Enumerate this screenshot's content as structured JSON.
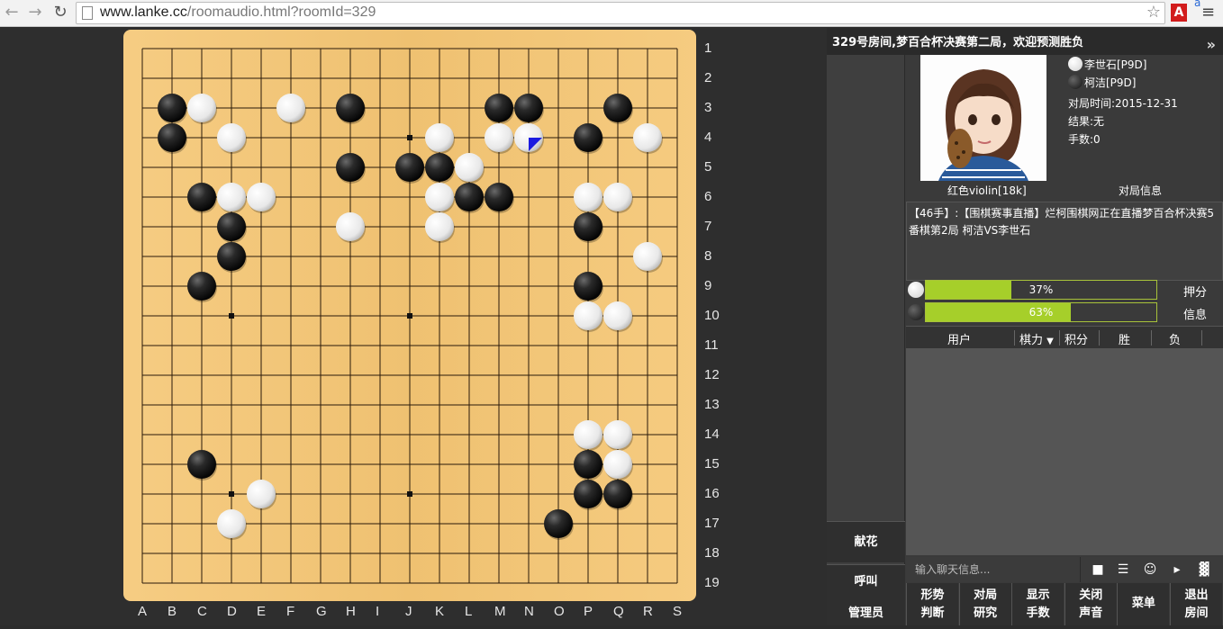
{
  "browser": {
    "url_host": "www.lanke.cc",
    "url_path": "/roomaudio.html?roomId=329",
    "ext_label": "A",
    "ext_badge": "a"
  },
  "board": {
    "size": 19,
    "col_labels": [
      "A",
      "B",
      "C",
      "D",
      "E",
      "F",
      "G",
      "H",
      "I",
      "J",
      "K",
      "L",
      "M",
      "N",
      "O",
      "P",
      "Q",
      "R",
      "S"
    ],
    "row_labels": [
      "1",
      "2",
      "3",
      "4",
      "5",
      "6",
      "7",
      "8",
      "9",
      "10",
      "11",
      "12",
      "13",
      "14",
      "15",
      "16",
      "17",
      "18",
      "19"
    ],
    "hoshi": [
      [
        4,
        4
      ],
      [
        10,
        4
      ],
      [
        16,
        4
      ],
      [
        4,
        10
      ],
      [
        10,
        10
      ],
      [
        16,
        10
      ],
      [
        4,
        16
      ],
      [
        10,
        16
      ],
      [
        16,
        16
      ]
    ],
    "black_stones": [
      [
        2,
        3
      ],
      [
        8,
        3
      ],
      [
        13,
        3
      ],
      [
        14,
        3
      ],
      [
        17,
        3
      ],
      [
        2,
        4
      ],
      [
        16,
        4
      ],
      [
        8,
        5
      ],
      [
        10,
        5
      ],
      [
        11,
        5
      ],
      [
        3,
        6
      ],
      [
        12,
        6
      ],
      [
        13,
        6
      ],
      [
        4,
        7
      ],
      [
        16,
        7
      ],
      [
        4,
        8
      ],
      [
        3,
        9
      ],
      [
        16,
        9
      ],
      [
        3,
        15
      ],
      [
        16,
        15
      ],
      [
        16,
        16
      ],
      [
        17,
        16
      ],
      [
        15,
        17
      ]
    ],
    "white_stones": [
      [
        3,
        3
      ],
      [
        6,
        3
      ],
      [
        4,
        4
      ],
      [
        11,
        4
      ],
      [
        13,
        4
      ],
      [
        14,
        4
      ],
      [
        18,
        4
      ],
      [
        12,
        5
      ],
      [
        4,
        6
      ],
      [
        5,
        6
      ],
      [
        11,
        6
      ],
      [
        16,
        6
      ],
      [
        17,
        6
      ],
      [
        8,
        7
      ],
      [
        11,
        7
      ],
      [
        18,
        8
      ],
      [
        16,
        10
      ],
      [
        17,
        10
      ],
      [
        16,
        14
      ],
      [
        17,
        14
      ],
      [
        17,
        15
      ],
      [
        5,
        16
      ],
      [
        4,
        17
      ]
    ],
    "last_move": [
      14,
      4
    ]
  },
  "panel": {
    "title": "329号房间,梦百合杯决赛第二局，欢迎预测胜负",
    "white_player": "李世石[P9D]",
    "black_player": "柯洁[P9D]",
    "date": "对局时间:2015-12-31",
    "result": "结果:无",
    "moves": "手数:0",
    "user_name": "红色violin[18k]",
    "game_info_label": "对局信息",
    "message": "【46手】:【围棋赛事直播】烂柯围棋网正在直播梦百合杯决赛5番棋第2局 柯洁VS李世石",
    "white_pct": "37%",
    "white_value": 0.37,
    "black_pct": "63%",
    "black_value": 0.63,
    "bet_label": "押分",
    "info_label": "信息",
    "table_headers": {
      "user": "用户",
      "strength": "棋力",
      "score": "积分",
      "win": "胜",
      "loss": "负"
    },
    "chat_placeholder": "输入聊天信息...",
    "flower_btn": "献花",
    "call_btn": "呼叫",
    "admin_btn": "管理员",
    "bottom_buttons": [
      {
        "l1": "形势",
        "l2": "判断"
      },
      {
        "l1": "对局",
        "l2": "研究"
      },
      {
        "l1": "显示",
        "l2": "手数"
      },
      {
        "l1": "关闭",
        "l2": "声音"
      },
      {
        "l1": "菜单",
        "l2": ""
      },
      {
        "l1": "退出",
        "l2": "房间"
      }
    ]
  },
  "colors": {
    "board": "#f5c878",
    "bar_fill": "#a6cf2a",
    "last_move_marker": "#1a1ae0"
  }
}
